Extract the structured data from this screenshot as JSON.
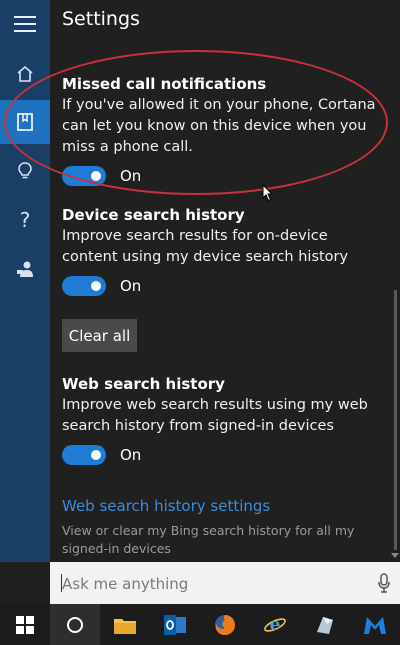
{
  "header": {
    "title": "Settings"
  },
  "sections": {
    "missed_call": {
      "heading": "Missed call notifications",
      "description": "If you've allowed it on your phone, Cortana can let you know on this device when you miss a phone call.",
      "toggle_label": "On"
    },
    "device_search": {
      "heading": "Device search history",
      "description": "Improve search results for on-device content using my device search history",
      "toggle_label": "On",
      "clear_label": "Clear all"
    },
    "web_search": {
      "heading": "Web search history",
      "description": "Improve web search results using my web search history from signed-in devices",
      "toggle_label": "On",
      "link_label": "Web search history settings",
      "note": "View or clear my Bing search history for all my signed-in devices"
    }
  },
  "search": {
    "placeholder": "Ask me anything"
  },
  "colors": {
    "accent": "#1e7cd6",
    "rail": "#1a3f66",
    "annotation": "#c8333b"
  }
}
